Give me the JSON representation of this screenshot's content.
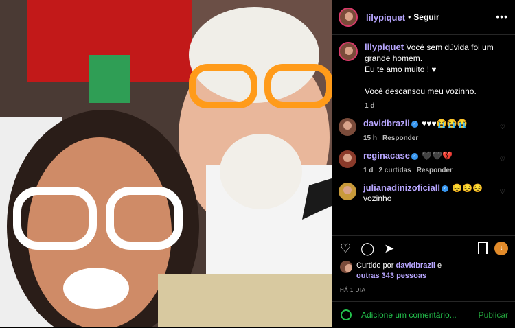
{
  "post": {
    "username": "lilypiquet",
    "follow_label": "Seguir",
    "caption": [
      "Você sem dúvida foi um grande homem.",
      "Eu te amo muito ! ♥",
      "",
      "Você descansou meu vozinho."
    ],
    "time": "1 d"
  },
  "comments": [
    {
      "user": "davidbrazil",
      "verified": true,
      "text": "♥♥♥😭😭😭",
      "time": "15 h",
      "reply": "Responder",
      "likes": ""
    },
    {
      "user": "reginacase",
      "verified": true,
      "text": "🖤🖤💔",
      "time": "1 d",
      "likes": "2 curtidas",
      "reply": "Responder"
    },
    {
      "user": "julianadinizoficiall",
      "verified": true,
      "text": "😔😔😔 vozinho",
      "time": "",
      "reply": "",
      "likes": ""
    }
  ],
  "likes": {
    "prefix": "Curtido por",
    "user": "davidbrazil",
    "and": "e",
    "others": "outras 343 pessoas"
  },
  "ago": "HÁ 1 DIA",
  "add_comment": {
    "placeholder": "Adicione um comentário...",
    "publish": "Publicar"
  },
  "colors": {
    "accent": "#b8a6ff",
    "comment_input": "#23c14c",
    "background": "#000000"
  }
}
